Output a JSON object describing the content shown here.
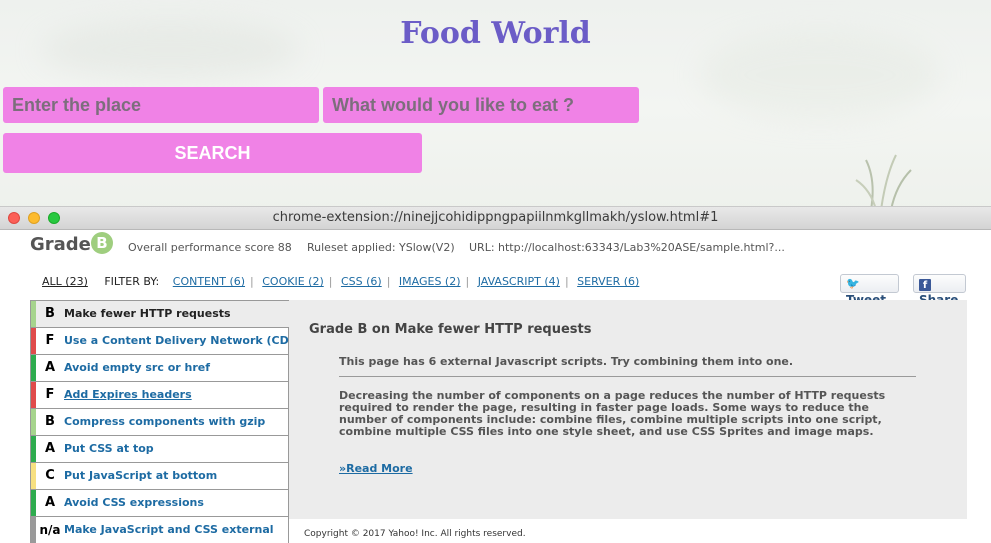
{
  "page": {
    "title": "Food World",
    "place_placeholder": "Enter the place",
    "food_placeholder": "What would you like to eat ?",
    "search_label": "SEARCH"
  },
  "window": {
    "url": "chrome-extension://ninejjcohidippngpapiilnmkgllmakh/yslow.html#1"
  },
  "yslow": {
    "grade_label": "Grade",
    "grade": "B",
    "grade_color": "#9fce7f",
    "overall": "Overall performance score 88",
    "ruleset": "Ruleset applied: YSlow(V2)",
    "url": "URL: http://localhost:63343/Lab3%20ASE/sample.html?...",
    "filter": {
      "all": "ALL (23)",
      "filter_by": "FILTER BY:",
      "options": [
        "CONTENT (6)",
        "COOKIE (2)",
        "CSS (6)",
        "IMAGES (2)",
        "JAVASCRIPT (4)",
        "SERVER (6)"
      ]
    },
    "tweet": "Tweet",
    "share": "Share",
    "rules": [
      {
        "grade": "B",
        "text": "Make fewer HTTP requests",
        "color": "#a6d48d"
      },
      {
        "grade": "F",
        "text": "Use a Content Delivery Network (CDN)",
        "color": "#e04b4b"
      },
      {
        "grade": "A",
        "text": "Avoid empty src or href",
        "color": "#2eab4e"
      },
      {
        "grade": "F",
        "text": "Add Expires headers",
        "color": "#e04b4b"
      },
      {
        "grade": "B",
        "text": "Compress components with gzip",
        "color": "#a6d48d"
      },
      {
        "grade": "A",
        "text": "Put CSS at top",
        "color": "#2eab4e"
      },
      {
        "grade": "C",
        "text": "Put JavaScript at bottom",
        "color": "#f7e081"
      },
      {
        "grade": "A",
        "text": "Avoid CSS expressions",
        "color": "#2eab4e"
      },
      {
        "grade": "n/a",
        "text": "Make JavaScript and CSS external",
        "color": "#9a9a9a"
      }
    ],
    "detail": {
      "title": "Grade B on Make fewer HTTP requests",
      "message": "This page has 6 external Javascript scripts. Try combining them into one.",
      "description": "Decreasing the number of components on a page reduces the number of HTTP requests required to render the page, resulting in faster page loads. Some ways to reduce the number of components include: combine files, combine multiple scripts into one script, combine multiple CSS files into one style sheet, and use CSS Sprites and image maps.",
      "read_more": "»Read More"
    },
    "copyright": "Copyright © 2017 Yahoo! Inc. All rights reserved."
  }
}
